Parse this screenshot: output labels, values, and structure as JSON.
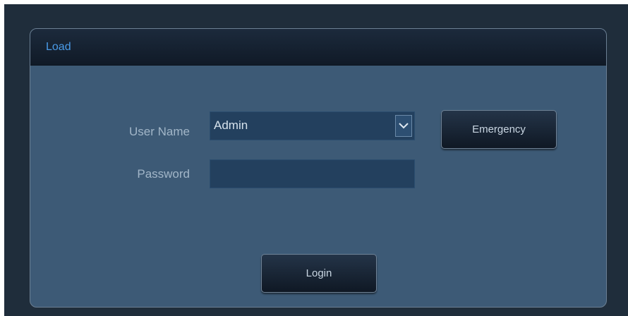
{
  "dialog": {
    "title": "Load"
  },
  "form": {
    "username_label": "User Name",
    "username_value": "Admin",
    "password_label": "Password",
    "password_value": ""
  },
  "buttons": {
    "emergency": "Emergency",
    "login": "Login"
  },
  "colors": {
    "background": "#1f2d3b",
    "panel": "#3d5a76",
    "title_text": "#4a9be8",
    "field": "#23405e"
  },
  "icons": {
    "dropdown": "chevron-down-icon"
  }
}
